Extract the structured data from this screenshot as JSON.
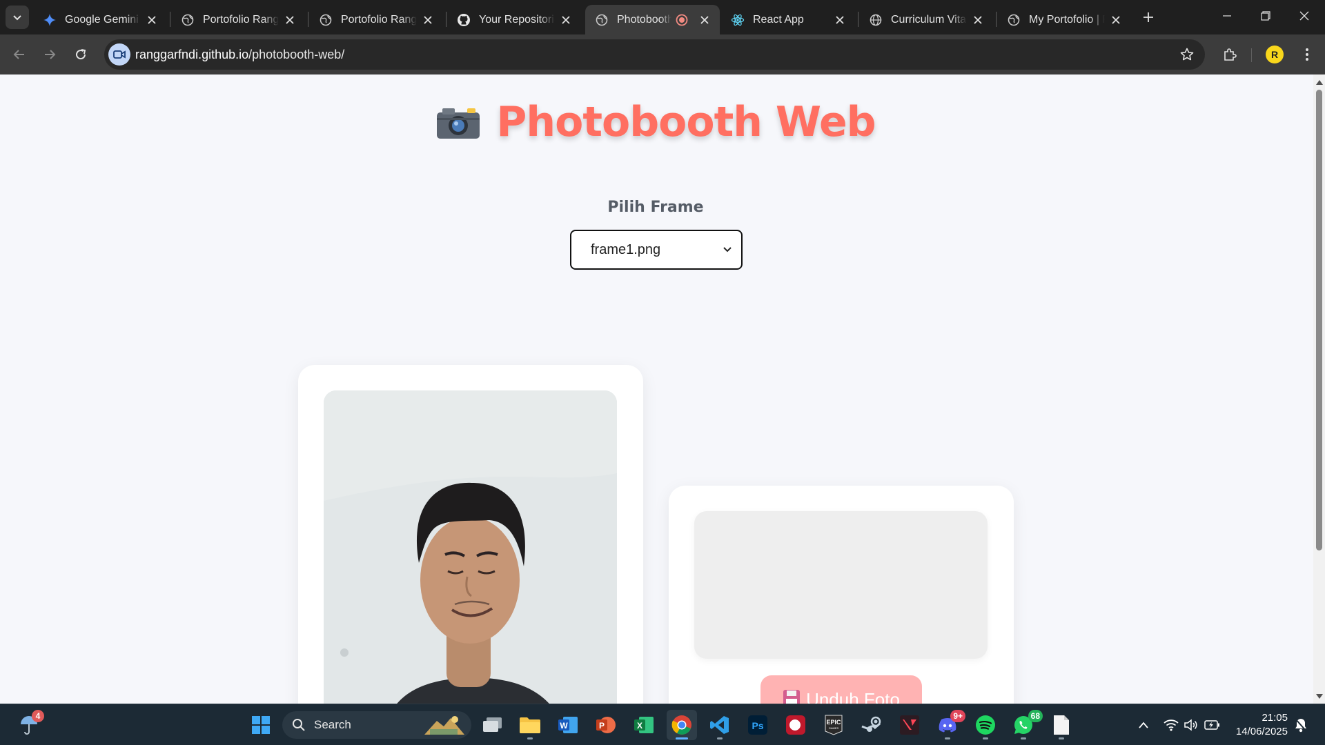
{
  "browser": {
    "tabs": [
      {
        "title": "Google Gemini",
        "icon": "gemini-icon"
      },
      {
        "title": "Portofolio Rangg",
        "icon": "globe-icon"
      },
      {
        "title": "Portofolio Rangg",
        "icon": "globe-icon"
      },
      {
        "title": "Your Repositories",
        "icon": "github-icon"
      },
      {
        "title": "Photobooth",
        "icon": "globe-icon",
        "active": true,
        "recording": true
      },
      {
        "title": "React App",
        "icon": "react-icon"
      },
      {
        "title": "Curriculum Vitae",
        "icon": "globe-icon"
      },
      {
        "title": "My Portofolio | R",
        "icon": "globe-icon"
      }
    ],
    "url_host": "ranggarfndi.github.io",
    "url_path": "/photobooth-web/",
    "profile_initial": "R"
  },
  "page": {
    "title": "Photobooth Web",
    "title_emoji": "📷",
    "frame_label": "Pilih Frame",
    "frame_selected": "frame1.png",
    "download_label": "Unduh Foto",
    "download_emoji": "💾"
  },
  "taskbar": {
    "search_placeholder": "Search",
    "weather_badge": "4",
    "discord_badge": "9+",
    "whatsapp_badge": "68",
    "time": "21:05",
    "date": "14/06/2025"
  },
  "colors": {
    "accent": "#ff6f61",
    "download_button": "#ffb3b3",
    "page_background": "#f6f7fb"
  }
}
